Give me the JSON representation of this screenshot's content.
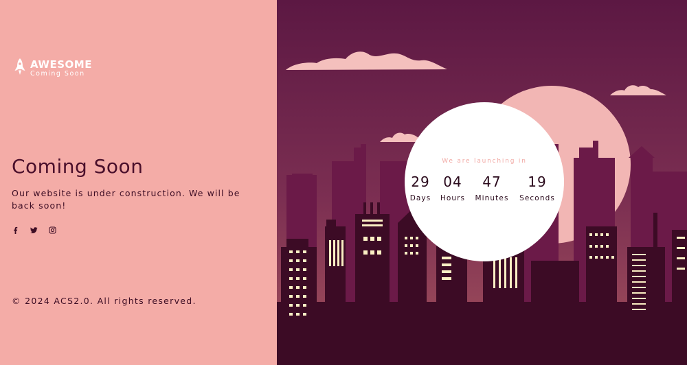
{
  "brand": {
    "title": "AWESOME",
    "subtitle": "Coming Soon",
    "icon": "rocket-icon"
  },
  "hero": {
    "heading": "Coming Soon",
    "description": "Our website is under construction. We will be back soon!"
  },
  "social": [
    {
      "name": "facebook-icon"
    },
    {
      "name": "twitter-icon"
    },
    {
      "name": "instagram-icon"
    }
  ],
  "footer": {
    "copyright": "© 2024 ACS2.0. All rights reserved."
  },
  "countdown": {
    "caption": "We are launching in",
    "units": [
      {
        "value": "29",
        "label": "Days"
      },
      {
        "value": "04",
        "label": "Hours"
      },
      {
        "value": "47",
        "label": "Minutes"
      },
      {
        "value": "19",
        "label": "Seconds"
      }
    ]
  },
  "colors": {
    "left_panel": "#f4aca7",
    "sky_top": "#5e1943",
    "sky_bottom": "#9a4a5a",
    "cloud": "#f4c0bd",
    "buildings_back": "#6b1a48",
    "buildings_front": "#3c0b25",
    "windows": "#fbefc4",
    "text_dark": "#3d0d24"
  }
}
